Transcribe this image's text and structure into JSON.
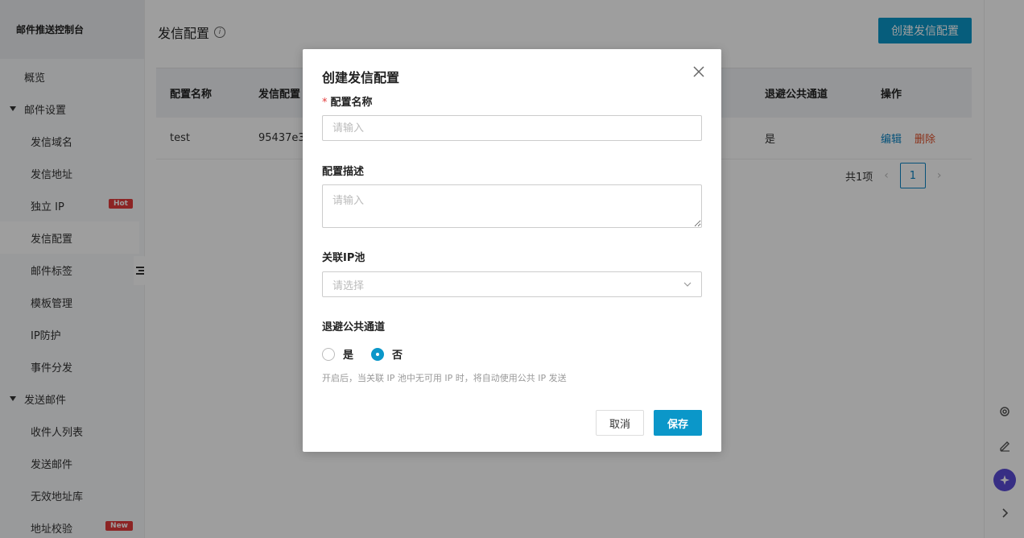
{
  "sidebar": {
    "title": "邮件推送控制台",
    "items": [
      {
        "label": "概览"
      },
      {
        "label": "邮件设置"
      },
      {
        "label": "发信域名"
      },
      {
        "label": "发信地址"
      },
      {
        "label": "独立 IP",
        "badge": "Hot"
      },
      {
        "label": "发信配置"
      },
      {
        "label": "邮件标签"
      },
      {
        "label": "模板管理"
      },
      {
        "label": "IP防护"
      },
      {
        "label": "事件分发"
      },
      {
        "label": "发送邮件"
      },
      {
        "label": "收件人列表"
      },
      {
        "label": "发送邮件"
      },
      {
        "label": "无效地址库"
      },
      {
        "label": "地址校验",
        "badge": "New"
      }
    ]
  },
  "main": {
    "title": "发信配置",
    "create_button": "创建发信配置",
    "table": {
      "headers": [
        "配置名称",
        "发信配置",
        "退避公共通道",
        "操作"
      ],
      "rows": [
        {
          "name": "test",
          "id": "95437e39",
          "fallback": "是",
          "edit": "编辑",
          "delete": "删除"
        }
      ]
    },
    "pager": {
      "total": "共1项",
      "page": "1"
    }
  },
  "dialog": {
    "title": "创建发信配置",
    "name_label": "配置名称",
    "name_placeholder": "请输入",
    "desc_label": "配置描述",
    "desc_placeholder": "请输入",
    "pool_label": "关联IP池",
    "pool_placeholder": "请选择",
    "fallback_label": "退避公共通道",
    "option_yes": "是",
    "option_no": "否",
    "hint": "开启后，当关联 IP 池中无可用 IP 时，将自动使用公共 IP 发送",
    "cancel": "取消",
    "save": "保存"
  }
}
